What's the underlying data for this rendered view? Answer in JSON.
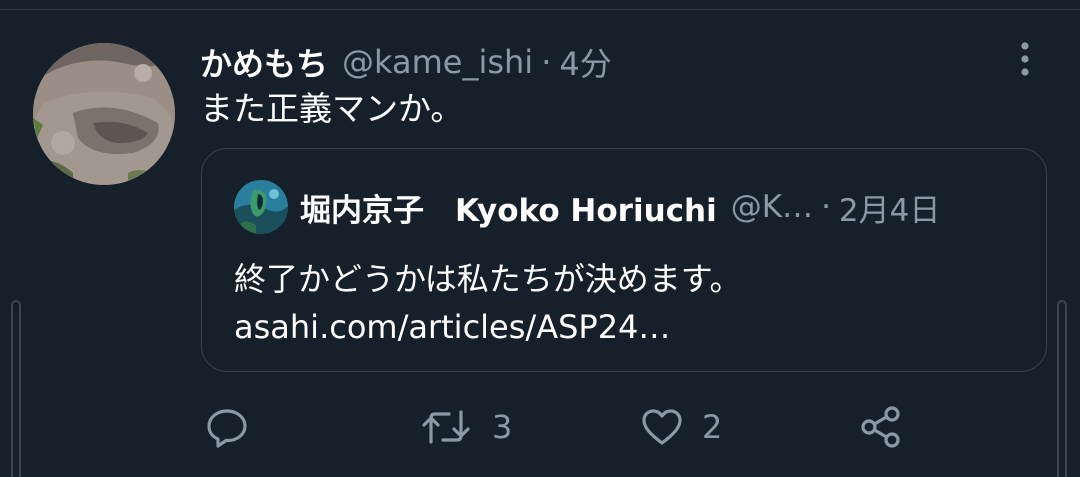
{
  "tweet": {
    "display_name": "かめもち",
    "handle": "@kame_ishi",
    "separator": "·",
    "time": "4分",
    "text": "また正義マンか。"
  },
  "quote": {
    "display_name": "堀内京子　Kyoko Horiuchi",
    "handle": "@K…",
    "separator": "·",
    "date": "2月4日",
    "text": "終了かどうかは私たちが決めます。asahi.com/articles/ASP24…"
  },
  "actions": {
    "retweet_count": "3",
    "like_count": "2"
  },
  "icons": {
    "reply": "reply-icon",
    "retweet": "retweet-icon",
    "like": "heart-icon",
    "share": "share-icon",
    "more": "more-vertical-icon"
  },
  "colors": {
    "background": "#15202b",
    "primary_text": "#ffffff",
    "secondary_text": "#8b98a5",
    "border": "#38444d"
  }
}
